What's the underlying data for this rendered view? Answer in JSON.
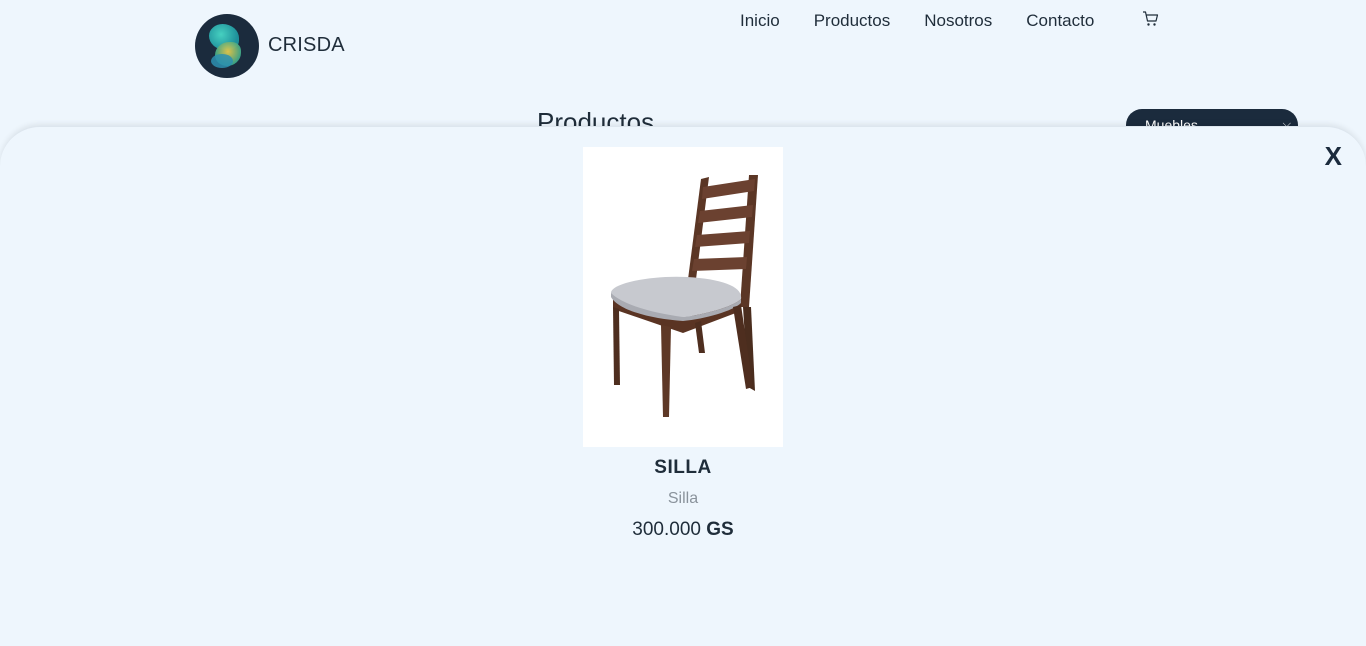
{
  "header": {
    "brand": "CRISDA",
    "nav": [
      {
        "label": "Inicio"
      },
      {
        "label": "Productos"
      },
      {
        "label": "Nosotros"
      },
      {
        "label": "Contacto"
      }
    ],
    "cart_icon": "cart-icon"
  },
  "background": {
    "section_title": "Productos",
    "category_select": {
      "selected": "Muebles"
    }
  },
  "modal": {
    "close_label": "X",
    "product": {
      "image_icon": "chair-image",
      "name": "SILLA",
      "description": "Silla",
      "price_amount": "300.000",
      "price_currency": "GS"
    }
  },
  "colors": {
    "background": "#eef6fd",
    "primary_dark": "#1b2b3d",
    "muted_text": "#8a939c"
  }
}
